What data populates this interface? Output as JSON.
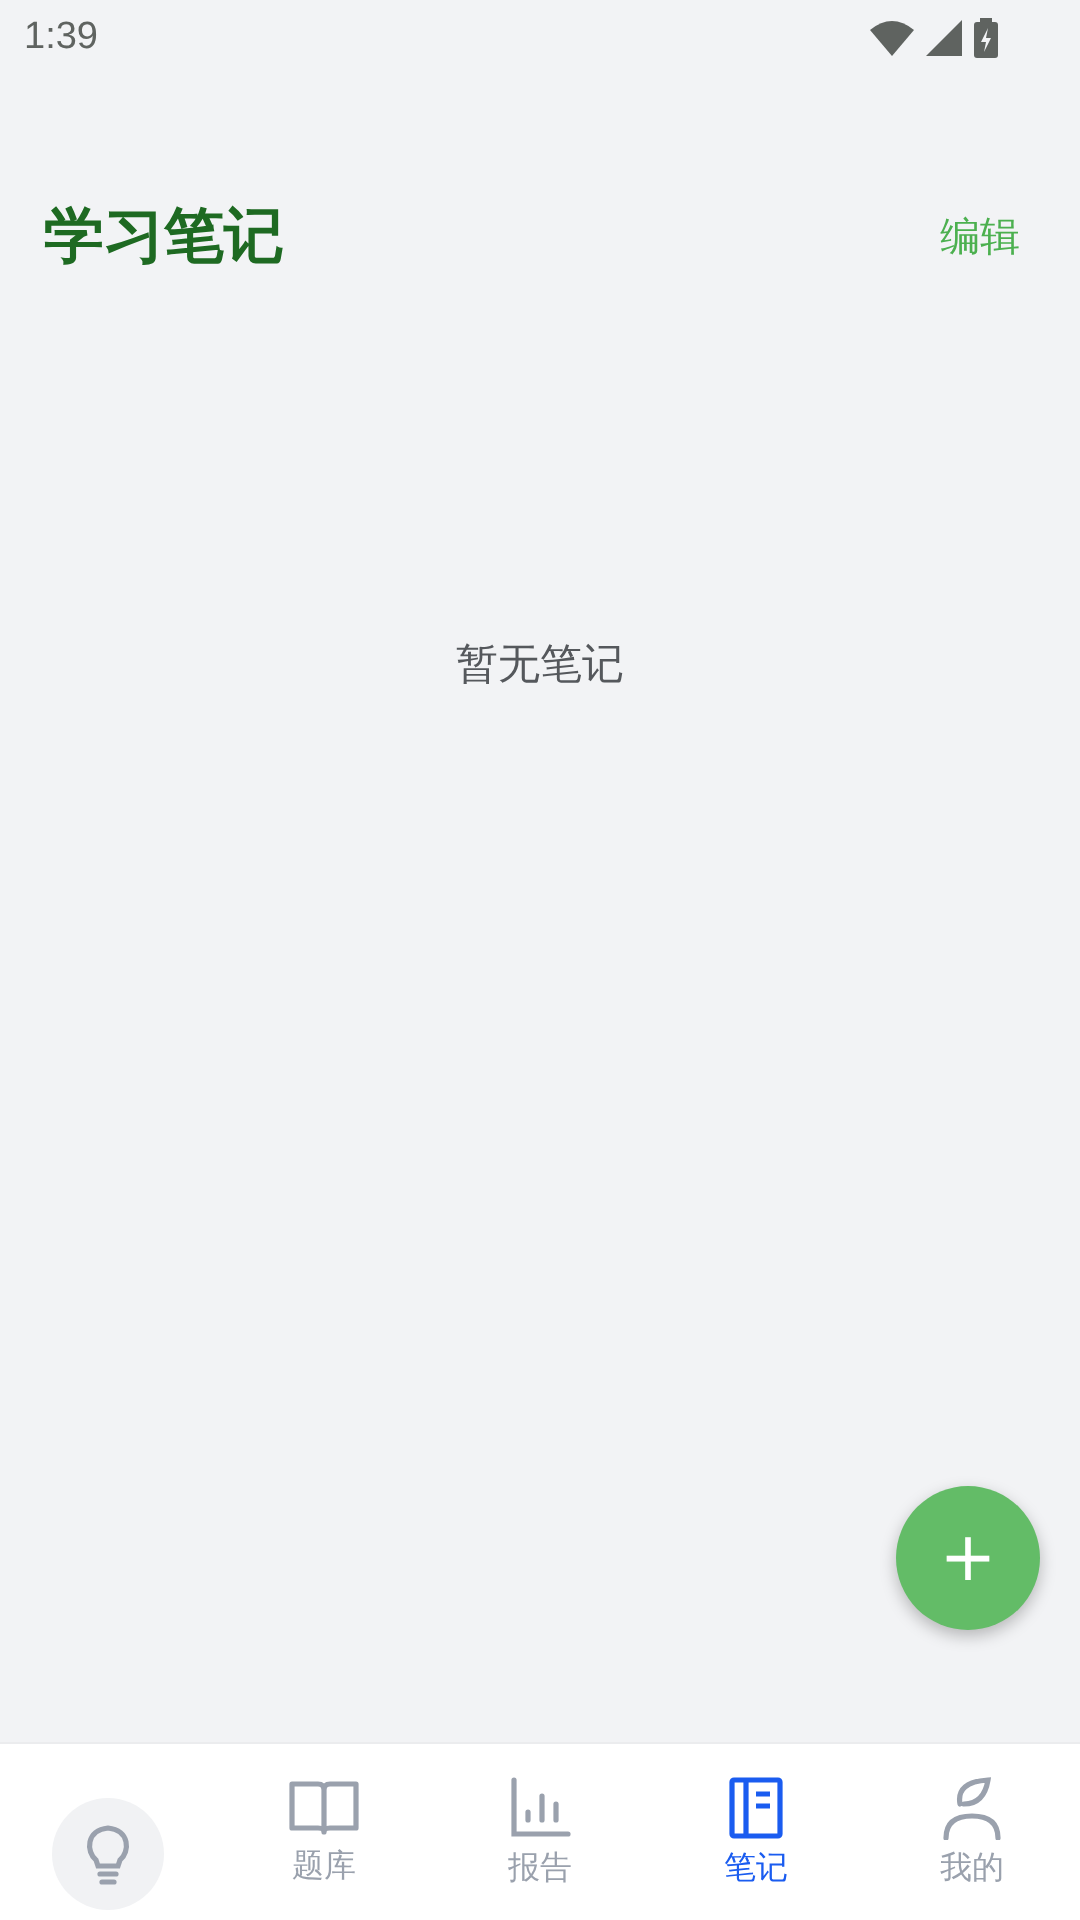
{
  "status_bar": {
    "time": "1:39"
  },
  "header": {
    "title": "学习笔记",
    "action": "编辑"
  },
  "empty_message": "暂无笔记",
  "fab": {
    "label": "+"
  },
  "bottom_nav": [
    {
      "kind": "book",
      "label": "题库",
      "selected": false
    },
    {
      "kind": "chart",
      "label": "报告",
      "selected": false
    },
    {
      "kind": "notebook",
      "label": "笔记",
      "selected": true
    },
    {
      "kind": "person",
      "label": "我的",
      "selected": false
    }
  ]
}
